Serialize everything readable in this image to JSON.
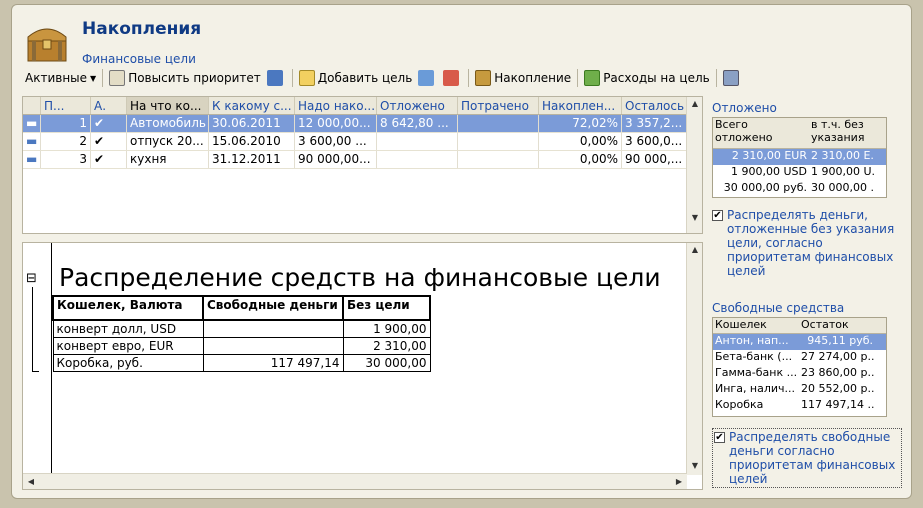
{
  "header": {
    "title": "Накопления",
    "subtitle": "Финансовые цели"
  },
  "toolbar": {
    "filter_label": "Активные",
    "raise_priority": "Повысить приоритет",
    "add_goal": "Добавить цель",
    "savings": "Накопление",
    "goal_expenses": "Расходы на цель"
  },
  "grid": {
    "columns": [
      "П...",
      "А.",
      "На что ко...",
      "К какому с...",
      "Надо нако...",
      "Отложено",
      "Потрачено",
      "Накоплен...",
      "Осталось"
    ],
    "rows": [
      {
        "priority": "1",
        "active": "✔",
        "name": "Автомобиль",
        "date": "30.06.2011",
        "need": "12 000,00...",
        "saved": "8 642,80 ...",
        "spent": "",
        "pct": "72,02%",
        "left": "3 357,2..."
      },
      {
        "priority": "2",
        "active": "✔",
        "name": "отпуск 20...",
        "date": "15.06.2010",
        "need": "3 600,00 ...",
        "saved": "",
        "spent": "",
        "pct": "0,00%",
        "left": "3 600,0..."
      },
      {
        "priority": "3",
        "active": "✔",
        "name": "кухня",
        "date": "31.12.2011",
        "need": "90 000,00...",
        "saved": "",
        "spent": "",
        "pct": "0,00%",
        "left": "90 000,..."
      }
    ]
  },
  "report": {
    "title": "Распределение средств на финансовые цели",
    "headers": [
      "Кошелек, Валюта",
      "Свободные деньги",
      "Без цели"
    ],
    "rows": [
      [
        "конверт долл, USD",
        "",
        "1 900,00"
      ],
      [
        "конверт евро, EUR",
        "",
        "2 310,00"
      ],
      [
        "Коробка, руб.",
        "117 497,14",
        "30 000,00"
      ]
    ],
    "collapse_glyph": "⊟"
  },
  "deferred": {
    "title": "Отложено",
    "headers": [
      "Всего отложено",
      "в т.ч. без указания"
    ],
    "rows": [
      [
        "2 310,00 EUR",
        "2 310,00 E..."
      ],
      [
        "1 900,00 USD",
        "1 900,00 U..."
      ],
      [
        "30 000,00 руб.",
        "30 000,00 ..."
      ]
    ],
    "checkbox_label": "Распределять деньги, отложенные без указания цели, согласно приоритетам финансовых целей"
  },
  "free": {
    "title": "Свободные средства",
    "headers": [
      "Кошелек",
      "Остаток"
    ],
    "rows": [
      [
        "Антон,  нап...",
        "945,11 руб."
      ],
      [
        "Бета-банк (...",
        "27 274,00 р..."
      ],
      [
        "Гамма-банк ...",
        "23 860,00 р..."
      ],
      [
        "Инга, налич...",
        "20 552,00 р..."
      ],
      [
        "Коробка",
        "117 497,14 ..."
      ]
    ],
    "checkbox_label": "Распределять свободные деньги согласно приоритетам финансовых целей"
  },
  "icons": {
    "filter_dropdown": "chevron-down-icon",
    "raise": "priority-up-icon",
    "move": "move-icon",
    "add": "add-goal-icon",
    "savings": "safe-icon",
    "expenses": "expense-icon",
    "settings": "settings-icon"
  },
  "colors": {
    "accent": "#0f3a84",
    "selection": "#7b9bd8",
    "background": "#f3f1e7"
  }
}
